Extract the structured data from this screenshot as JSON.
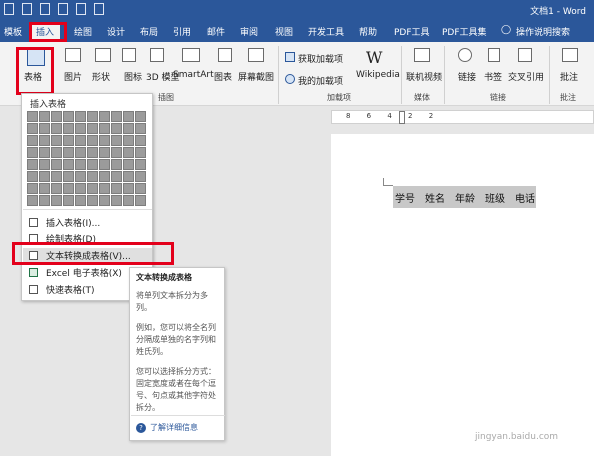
{
  "titlebar": {
    "title": "文档1 - Word"
  },
  "tabs": [
    "模板",
    "插入",
    "绘图",
    "设计",
    "布局",
    "引用",
    "邮件",
    "审阅",
    "视图",
    "开发工具",
    "帮助",
    "PDF工具",
    "PDF工具集",
    "操作说明搜索"
  ],
  "ribbon": {
    "table": "表格",
    "picture": "图片",
    "shape": "形状",
    "icon": "图标",
    "model": "3D 模型",
    "smartart": "SmartArt",
    "chart": "图表",
    "screenshot": "屏幕截图",
    "get_addins": "获取加载项",
    "my_addins": "我的加载项",
    "wikipedia": "Wikipedia",
    "online_video": "联机视频",
    "link": "链接",
    "bookmark": "书签",
    "cross_ref": "交叉引用",
    "comment": "批注",
    "groups": {
      "illustrations": "插图",
      "addins": "加载项",
      "media": "媒体",
      "links": "链接",
      "comments": "批注"
    }
  },
  "menu": {
    "header": "插入表格",
    "items": [
      "插入表格(I)...",
      "绘制表格(D)",
      "文本转换成表格(V)...",
      "Excel 电子表格(X)",
      "快速表格(T)"
    ]
  },
  "tooltip": {
    "title": "文本转换成表格",
    "p1": "将单列文本拆分为多列。",
    "p2": "例如，您可以将全名列分隔成单独的名字列和姓氏列。",
    "p3": "您可以选择拆分方式：固定宽度或者在每个逗号、句点或其他字符处拆分。",
    "link": "了解详细信息"
  },
  "ruler": {
    "numbers": "8 6 4 2 2"
  },
  "document": {
    "row": [
      "学号",
      "姓名",
      "年龄",
      "班级",
      "电话"
    ]
  },
  "watermark": {
    "brand": "Baidu经验",
    "url": "jingyan.baidu.com"
  },
  "colors": {
    "accent": "#2b579a",
    "highlight": "#e3001b"
  }
}
